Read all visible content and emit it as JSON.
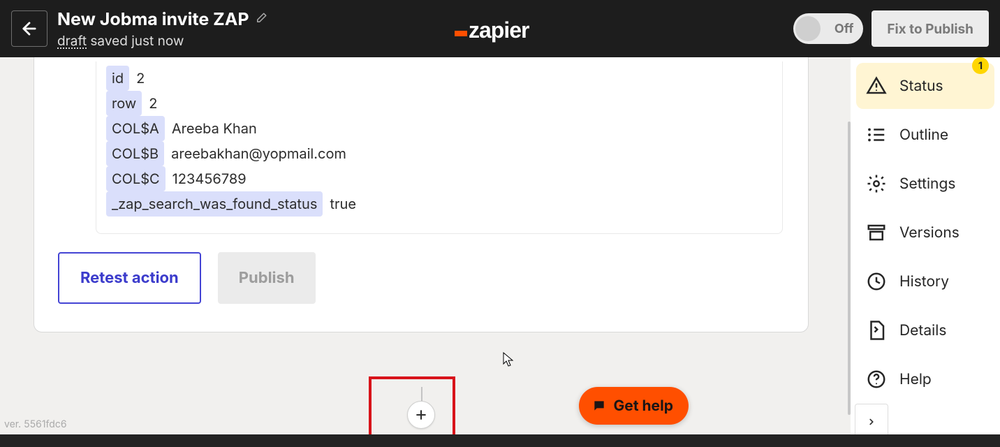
{
  "header": {
    "title": "New Jobma invite ZAP",
    "draft_label": "draft",
    "saved_text": " saved just now",
    "toggle_label": "Off",
    "fix_label": "Fix to Publish",
    "logo_text": "zapier"
  },
  "fields": [
    {
      "key": "id",
      "value": "2"
    },
    {
      "key": "row",
      "value": "2"
    },
    {
      "key": "COL$A",
      "value": "Areeba Khan"
    },
    {
      "key": "COL$B",
      "value": "areebakhan@yopmail.com"
    },
    {
      "key": "COL$C",
      "value": "123456789"
    },
    {
      "key": "_zap_search_was_found_status",
      "value": "true"
    }
  ],
  "buttons": {
    "retest": "Retest action",
    "publish": "Publish"
  },
  "sidebar": {
    "items": [
      {
        "label": "Status",
        "badge": "1",
        "active": true
      },
      {
        "label": "Outline"
      },
      {
        "label": "Settings"
      },
      {
        "label": "Versions"
      },
      {
        "label": "History"
      },
      {
        "label": "Details"
      },
      {
        "label": "Help"
      }
    ]
  },
  "get_help": "Get help",
  "version": "ver. 5561fdc6"
}
